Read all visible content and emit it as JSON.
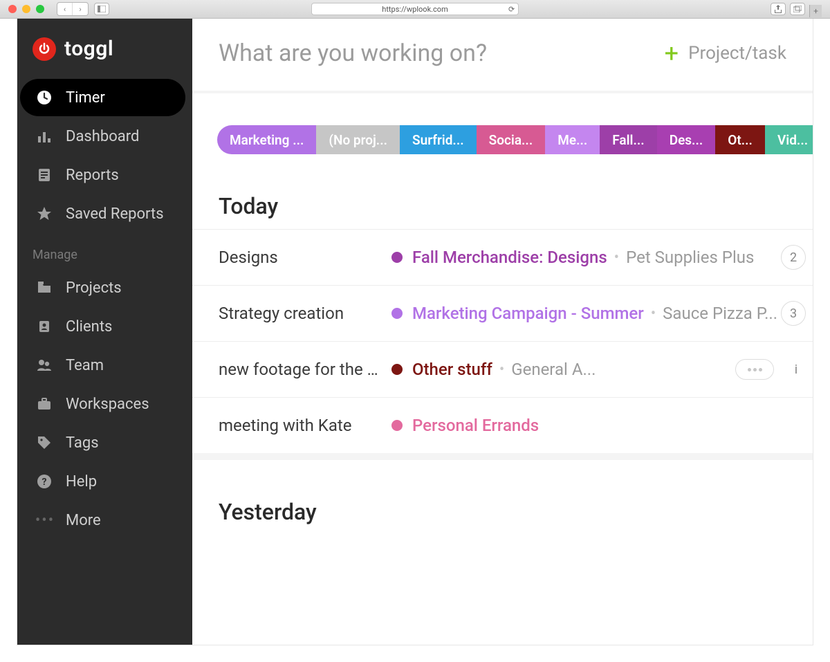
{
  "browser": {
    "url": "https://wplook.com"
  },
  "app": {
    "brand": "toggl"
  },
  "sidebar": {
    "items": [
      {
        "label": "Timer",
        "icon": "clock-icon",
        "active": true
      },
      {
        "label": "Dashboard",
        "icon": "chart-icon",
        "active": false
      },
      {
        "label": "Reports",
        "icon": "page-icon",
        "active": false
      },
      {
        "label": "Saved Reports",
        "icon": "star-icon",
        "active": false
      }
    ],
    "manage_label": "Manage",
    "manage_items": [
      {
        "label": "Projects",
        "icon": "folder-icon"
      },
      {
        "label": "Clients",
        "icon": "person-icon"
      },
      {
        "label": "Team",
        "icon": "team-icon"
      },
      {
        "label": "Workspaces",
        "icon": "briefcase-icon"
      },
      {
        "label": "Tags",
        "icon": "tag-icon"
      },
      {
        "label": "Help",
        "icon": "help-icon"
      },
      {
        "label": "More",
        "icon": "more-icon"
      }
    ]
  },
  "topbar": {
    "placeholder": "What are you working on?",
    "project_task_label": "Project/task"
  },
  "chips": [
    {
      "label": "Marketing ...",
      "color": "#b172e6"
    },
    {
      "label": "(No proj...",
      "color": "#c6c6c6"
    },
    {
      "label": "Surfrid...",
      "color": "#2d9fe0"
    },
    {
      "label": "Socia...",
      "color": "#d75a93"
    },
    {
      "label": "Me...",
      "color": "#c486ef"
    },
    {
      "label": "Fall...",
      "color": "#9d3fa8"
    },
    {
      "label": "Des...",
      "color": "#a83fb1"
    },
    {
      "label": "Ot...",
      "color": "#7d1612"
    },
    {
      "label": "Vid...",
      "color": "#4cbfa0"
    }
  ],
  "sections": [
    {
      "title": "Today",
      "entries": [
        {
          "description": "Designs",
          "project": "Fall Merchandise: Designs",
          "project_color": "#9d3fa8",
          "client": "Pet Supplies Plus",
          "badge_count": "2",
          "more_menu": false
        },
        {
          "description": "Strategy creation",
          "project": "Marketing Campaign - Summer",
          "project_color": "#b172e6",
          "client": "Sauce Pizza P...",
          "badge_count": "3",
          "more_menu": false
        },
        {
          "description": "new footage for the clip",
          "project": "Other stuff",
          "project_color": "#7d1612",
          "client": "General A...",
          "badge_count": null,
          "more_menu": true,
          "trailing_text": "i"
        },
        {
          "description": "meeting with Kate",
          "project": "Personal Errands",
          "project_color": "#e36a9e",
          "client": null,
          "badge_count": null,
          "more_menu": false
        }
      ]
    },
    {
      "title": "Yesterday",
      "entries": []
    }
  ]
}
